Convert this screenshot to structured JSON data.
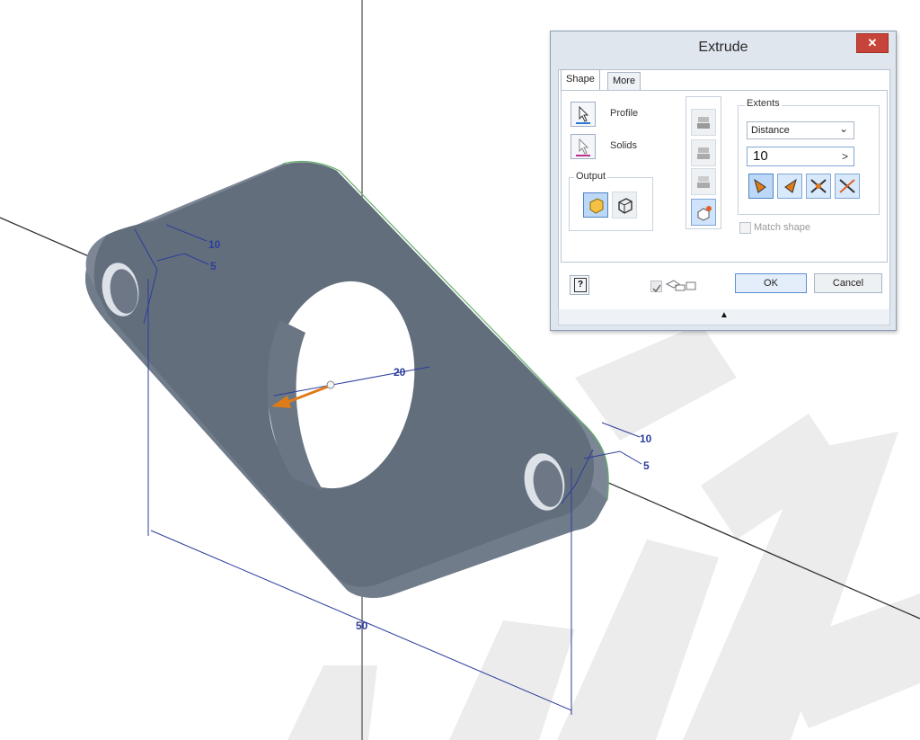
{
  "viewport": {
    "dimensions": {
      "thickness_left": "10",
      "offset_left": "5",
      "hole_diameter": "20",
      "thickness_right": "10",
      "offset_right": "5",
      "overall_length": "50"
    }
  },
  "dialog": {
    "title": "Extrude",
    "close_glyph": "✕",
    "tabs": [
      {
        "label": "Shape"
      },
      {
        "label": "More"
      }
    ],
    "profile_label": "Profile",
    "solids_label": "Solids",
    "output_title": "Output",
    "extents_title": "Extents",
    "extents_type": "Distance",
    "distance_value": "10",
    "match_shape_label": "Match shape",
    "ok_label": "OK",
    "cancel_label": "Cancel",
    "help_glyph": "?",
    "expand_glyph": "▲",
    "select_arrow": "⌄",
    "more_arrow": ">"
  },
  "colors": {
    "part_top": "#626e7c",
    "part_side": "#7c8695",
    "dimension": "#2d3d9c",
    "accent": "#e07b1a"
  }
}
